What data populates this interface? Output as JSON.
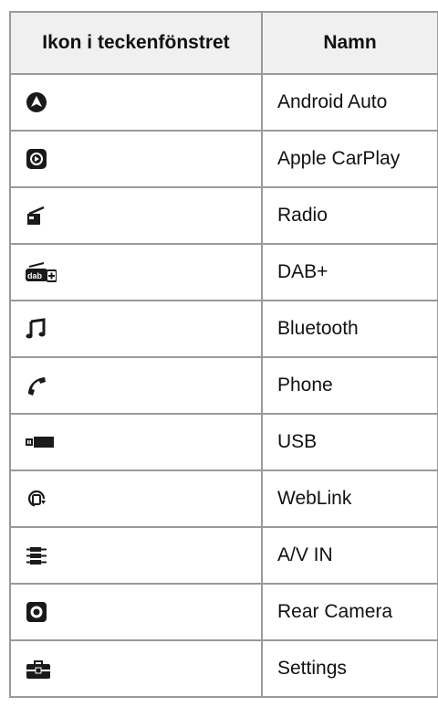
{
  "table": {
    "headers": {
      "icon": "Ikon i teckenfönstret",
      "name": "Namn"
    },
    "rows": [
      {
        "icon": "android-auto-icon",
        "name": "Android Auto"
      },
      {
        "icon": "apple-carplay-icon",
        "name": "Apple CarPlay"
      },
      {
        "icon": "radio-icon",
        "name": "Radio"
      },
      {
        "icon": "dab-plus-icon",
        "name": "DAB+"
      },
      {
        "icon": "bluetooth-music-icon",
        "name": "Bluetooth"
      },
      {
        "icon": "phone-icon",
        "name": "Phone"
      },
      {
        "icon": "usb-icon",
        "name": "USB"
      },
      {
        "icon": "weblink-icon",
        "name": "WebLink"
      },
      {
        "icon": "av-in-icon",
        "name": "A/V IN"
      },
      {
        "icon": "rear-camera-icon",
        "name": "Rear Camera"
      },
      {
        "icon": "settings-icon",
        "name": "Settings"
      }
    ]
  },
  "colors": {
    "border": "#9a9a9a",
    "header_bg": "#f0f0f0",
    "icon": "#1a1a1a"
  }
}
